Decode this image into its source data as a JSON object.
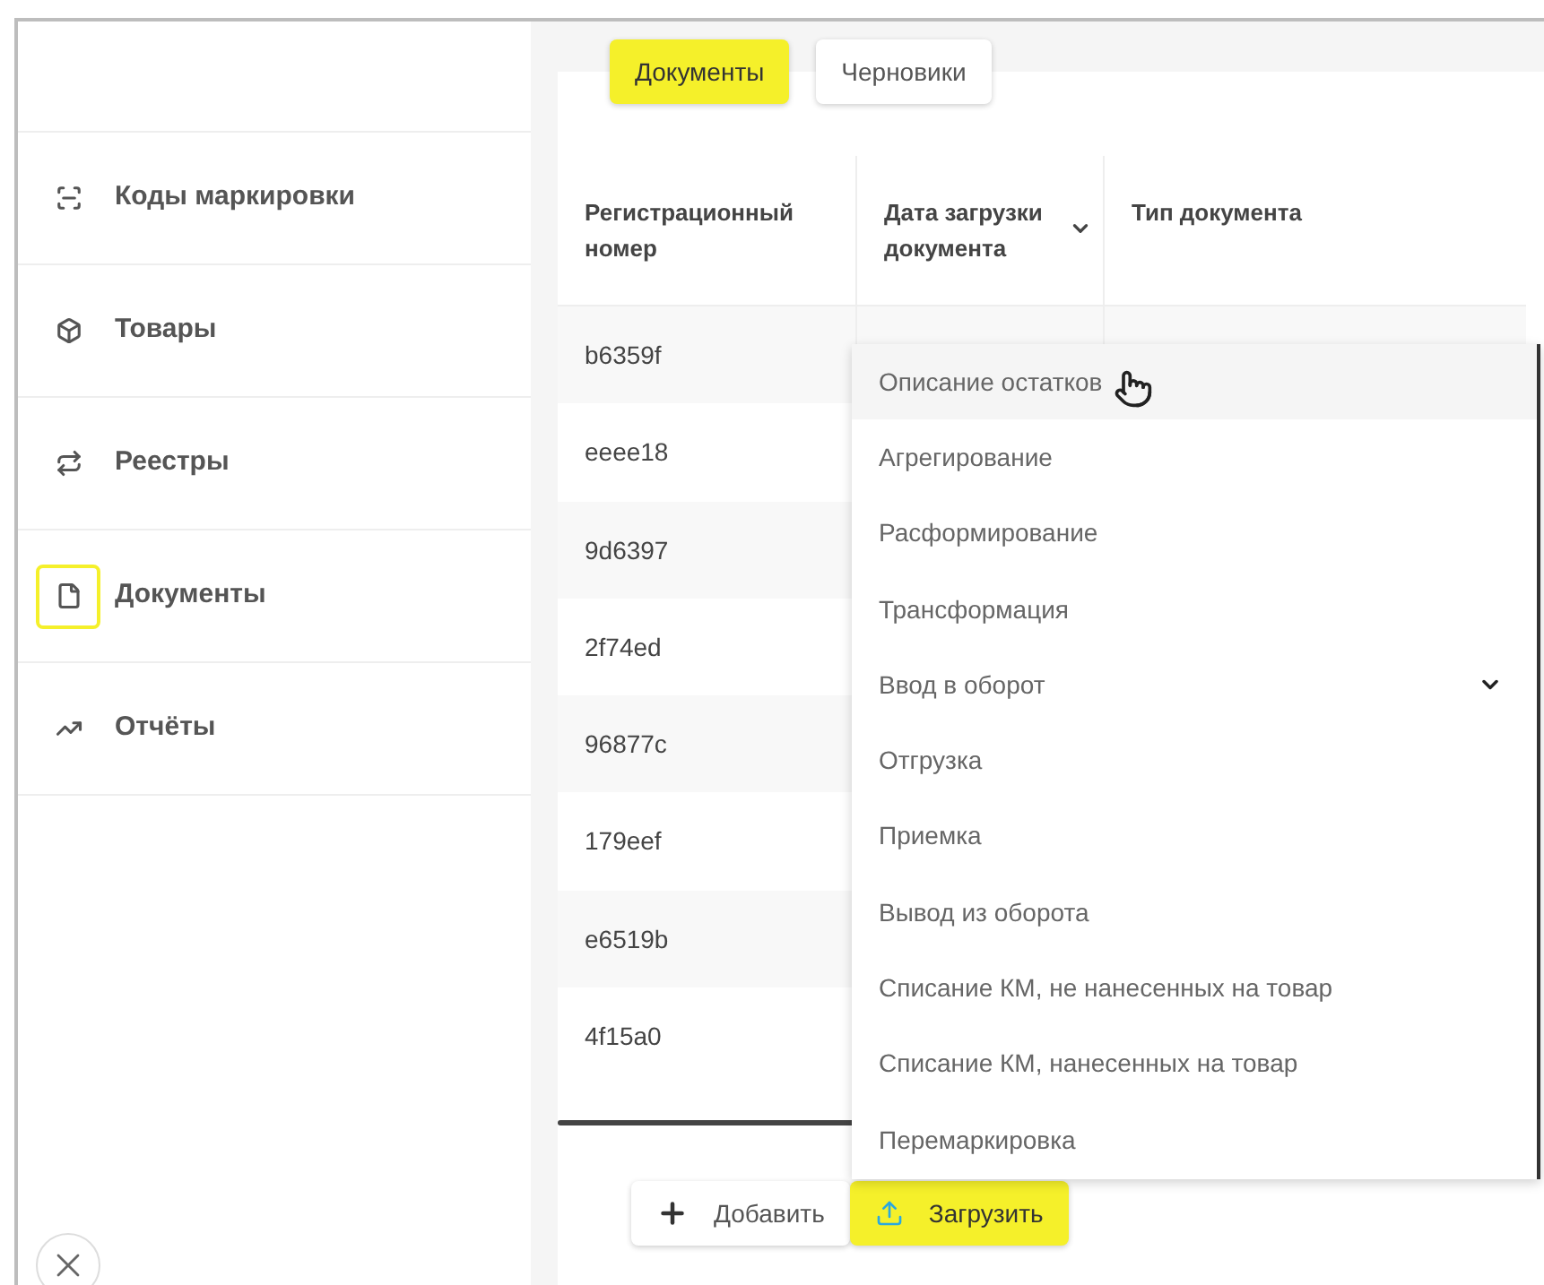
{
  "sidebar": {
    "items": [
      {
        "label": "Коды маркировки",
        "selected": false
      },
      {
        "label": "Товары",
        "selected": false
      },
      {
        "label": "Реестры",
        "selected": false
      },
      {
        "label": "Документы",
        "selected": true
      },
      {
        "label": "Отчёты",
        "selected": false
      }
    ]
  },
  "tabs": [
    {
      "label": "Документы",
      "selected": true
    },
    {
      "label": "Черновики",
      "selected": false
    }
  ],
  "table": {
    "columns": [
      {
        "label": "Регистрационный номер",
        "sortable": false
      },
      {
        "label": "Дата загрузки документа",
        "sortable": true
      },
      {
        "label": "Тип документа",
        "sortable": false
      }
    ],
    "rows": [
      "b6359f",
      "eeee18",
      "9d6397",
      "2f74ed",
      "96877c",
      "179eef",
      "e6519b",
      "4f15a0"
    ]
  },
  "dropdown": {
    "items": [
      {
        "label": "Описание остатков",
        "selected": true,
        "expandable": false
      },
      {
        "label": "Агрегирование",
        "selected": false,
        "expandable": false
      },
      {
        "label": "Расформирование",
        "selected": false,
        "expandable": false
      },
      {
        "label": "Трансформация",
        "selected": false,
        "expandable": false
      },
      {
        "label": "Ввод в оборот",
        "selected": false,
        "expandable": true
      },
      {
        "label": "Отгрузка",
        "selected": false,
        "expandable": false
      },
      {
        "label": "Приемка",
        "selected": false,
        "expandable": false
      },
      {
        "label": "Вывод из оборота",
        "selected": false,
        "expandable": false
      },
      {
        "label": "Списание КМ, не нанесенных на товар",
        "selected": false,
        "expandable": false
      },
      {
        "label": "Списание КМ, нанесенных на товар",
        "selected": false,
        "expandable": false
      },
      {
        "label": "Перемаркировка",
        "selected": false,
        "expandable": false
      }
    ]
  },
  "buttons": [
    {
      "label": "Добавить",
      "kind": "add"
    },
    {
      "label": "Загрузить",
      "kind": "upload"
    }
  ]
}
